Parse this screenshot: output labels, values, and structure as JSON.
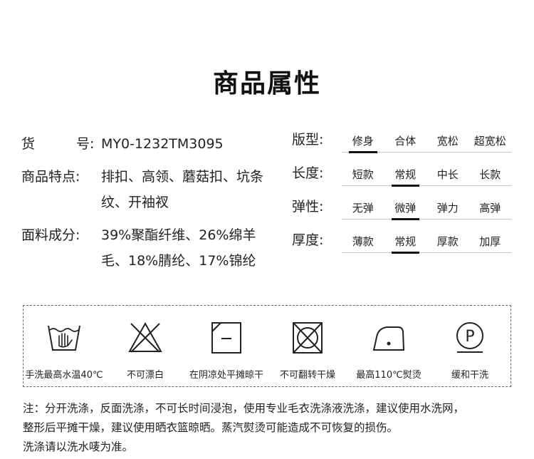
{
  "title": "商品属性",
  "props": {
    "item_no_label_a": "货",
    "item_no_label_b": "号",
    "item_no_colon": ":",
    "item_no_value": "MY0-1232TM3095",
    "features_label": "商品特点:",
    "features_value": "排扣、高领、蘑菇扣、坑条纹、开袖衩",
    "fabric_label": "面料成分:",
    "fabric_value": "39%聚酯纤维、26%绵羊毛、18%腈纶、17%锦纶"
  },
  "specs": [
    {
      "label": "版型:",
      "options": [
        "修身",
        "合体",
        "宽松",
        "超宽松"
      ],
      "selected": 0
    },
    {
      "label": "长度:",
      "options": [
        "短款",
        "常规",
        "中长",
        "长款"
      ],
      "selected": 1
    },
    {
      "label": "弹性:",
      "options": [
        "无弹",
        "微弹",
        "弹力",
        "高弹"
      ],
      "selected": 1
    },
    {
      "label": "厚度:",
      "options": [
        "薄款",
        "常规",
        "厚款",
        "加厚"
      ],
      "selected": 1
    }
  ],
  "care": [
    {
      "icon": "hand-wash-icon",
      "label": "手洗最高水温40℃"
    },
    {
      "icon": "do-not-bleach-icon",
      "label": "不可漂白"
    },
    {
      "icon": "dry-flat-in-shade-icon",
      "label": "在阴凉处平摊晾干"
    },
    {
      "icon": "do-not-tumble-dry-icon",
      "label": "不可翻转干燥"
    },
    {
      "icon": "iron-110-icon",
      "label": "最高110℃熨烫"
    },
    {
      "icon": "gentle-dry-clean-icon",
      "label": "缓和干洗",
      "icon_letter": "P"
    }
  ],
  "note": {
    "line1": "注：分开洗涤，反面洗涤，不可长时间浸泡，使用专业毛衣洗涤液洗涤，建议使用水洗网，",
    "line2": "整形后平摊干燥，建议使用晒衣篮晾晒。蒸汽熨烫可能造成不可恢复的损伤。",
    "line3": "洗涤请以洗水唛为准。"
  }
}
